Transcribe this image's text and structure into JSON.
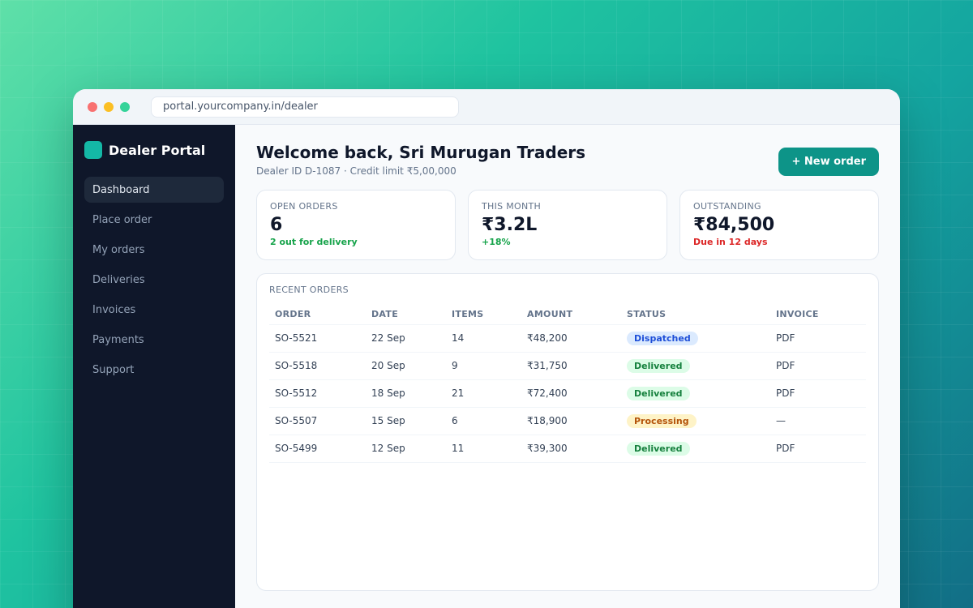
{
  "browser": {
    "url": "portal.yourcompany.in/dealer"
  },
  "sidebar": {
    "brand": "Dealer Portal",
    "items": [
      {
        "label": "Dashboard",
        "active": true
      },
      {
        "label": "Place order"
      },
      {
        "label": "My orders"
      },
      {
        "label": "Deliveries"
      },
      {
        "label": "Invoices"
      },
      {
        "label": "Payments"
      },
      {
        "label": "Support"
      }
    ]
  },
  "header": {
    "title": "Welcome back, Sri Murugan Traders",
    "subtitle": "Dealer ID D-1087 · Credit limit ₹5,00,000",
    "new_order_label": "+ New order"
  },
  "stats": [
    {
      "label": "OPEN ORDERS",
      "value": "6",
      "note": "2 out for delivery",
      "note_color": "#16a34a"
    },
    {
      "label": "THIS MONTH",
      "value": "₹3.2L",
      "note": "+18%",
      "note_color": "#16a34a"
    },
    {
      "label": "OUTSTANDING",
      "value": "₹84,500",
      "note": "Due in 12 days",
      "note_color": "#dc2626"
    }
  ],
  "orders": {
    "title": "RECENT ORDERS",
    "columns": [
      "ORDER",
      "DATE",
      "ITEMS",
      "AMOUNT",
      "STATUS",
      "INVOICE"
    ],
    "rows": [
      {
        "order": "SO-5521",
        "date": "22 Sep",
        "items": "14",
        "amount": "₹48,200",
        "status": "Dispatched",
        "status_type": "dispatched",
        "invoice": "PDF"
      },
      {
        "order": "SO-5518",
        "date": "20 Sep",
        "items": "9",
        "amount": "₹31,750",
        "status": "Delivered",
        "status_type": "delivered",
        "invoice": "PDF"
      },
      {
        "order": "SO-5512",
        "date": "18 Sep",
        "items": "21",
        "amount": "₹72,400",
        "status": "Delivered",
        "status_type": "delivered",
        "invoice": "PDF"
      },
      {
        "order": "SO-5507",
        "date": "15 Sep",
        "items": "6",
        "amount": "₹18,900",
        "status": "Processing",
        "status_type": "processing",
        "invoice": "—"
      },
      {
        "order": "SO-5499",
        "date": "12 Sep",
        "items": "11",
        "amount": "₹39,300",
        "status": "Delivered",
        "status_type": "delivered",
        "invoice": "PDF"
      }
    ]
  }
}
